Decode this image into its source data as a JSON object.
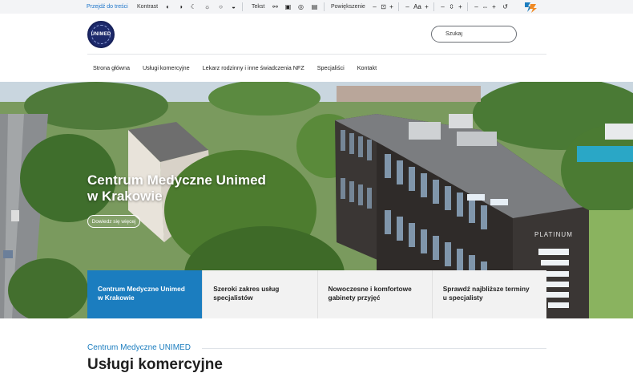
{
  "toolbar": {
    "skip_link": "Przejdź do treści",
    "contrast_label": "Kontrast",
    "text_label": "Tekst",
    "zoom_label": "Powiększenie",
    "font_size_glyph": "Aa",
    "icons": [
      "contrast-icon",
      "contrast-half-icon",
      "moon-icon",
      "sun-icon",
      "circle-icon",
      "cup-icon",
      "link-icon",
      "grid-icon",
      "circle-check-icon",
      "doc-icon",
      "magnify-icon",
      "font-size-icon",
      "line-height-icon",
      "letter-spacing-icon",
      "reset-icon"
    ]
  },
  "header": {
    "logo_text": "UNIMED",
    "search_placeholder": "Szukaj"
  },
  "nav": {
    "items": [
      "Strona główna",
      "Usługi komercyjne",
      "Lekarz rodzinny i inne świadczenia NFZ",
      "Specjaliści",
      "Kontakt"
    ]
  },
  "hero": {
    "title_line1": "Centrum Medyczne Unimed",
    "title_line2": "w Krakowie",
    "button_label": "Dowiedz się więcej",
    "building_sign": "PLATINUM"
  },
  "cards": [
    {
      "line1": "Centrum Medyczne Unimed",
      "line2": "w Krakowie",
      "active": true
    },
    {
      "line1": "Szeroki zakres usług",
      "line2": "specjalistów",
      "active": false
    },
    {
      "line1": "Nowoczesne i komfortowe",
      "line2": "gabinety przyjęć",
      "active": false
    },
    {
      "line1": "Sprawdź najbliższe terminy",
      "line2": "u specjalisty",
      "active": false
    }
  ],
  "section": {
    "eyebrow": "Centrum Medyczne UNIMED",
    "title": "Usługi komercyjne"
  },
  "colors": {
    "accent": "#1b7dbf",
    "navy_logo": "#1d2a6b"
  }
}
